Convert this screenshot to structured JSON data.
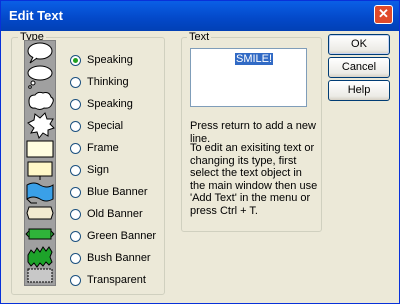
{
  "window": {
    "title": "Edit Text"
  },
  "type_group": {
    "label": "Type",
    "options": [
      {
        "label": "Speaking",
        "checked": true,
        "icon": "speech-bubble-icon"
      },
      {
        "label": "Thinking",
        "checked": false,
        "icon": "thought-bubble-icon"
      },
      {
        "label": "Speaking",
        "checked": false,
        "icon": "speech-cloud-icon"
      },
      {
        "label": "Special",
        "checked": false,
        "icon": "burst-bubble-icon"
      },
      {
        "label": "Frame",
        "checked": false,
        "icon": "frame-icon"
      },
      {
        "label": "Sign",
        "checked": false,
        "icon": "sign-icon"
      },
      {
        "label": "Blue Banner",
        "checked": false,
        "icon": "blue-banner-icon"
      },
      {
        "label": "Old Banner",
        "checked": false,
        "icon": "old-banner-icon"
      },
      {
        "label": "Green Banner",
        "checked": false,
        "icon": "green-banner-icon"
      },
      {
        "label": "Bush Banner",
        "checked": false,
        "icon": "bush-banner-icon"
      },
      {
        "label": "Transparent",
        "checked": false,
        "icon": "transparent-icon"
      }
    ]
  },
  "text_group": {
    "label": "Text",
    "value": "SMILE!",
    "hint": "Press return to add a new line.",
    "help": "To edit an exisiting text or changing its type, first select the text object in the main window then use 'Add Text' in the menu or press Ctrl + T."
  },
  "buttons": {
    "ok": "OK",
    "cancel": "Cancel",
    "help": "Help"
  },
  "colors": {
    "titlebar": "#0348c8",
    "face": "#ece9d8",
    "selection": "#316ac5"
  }
}
